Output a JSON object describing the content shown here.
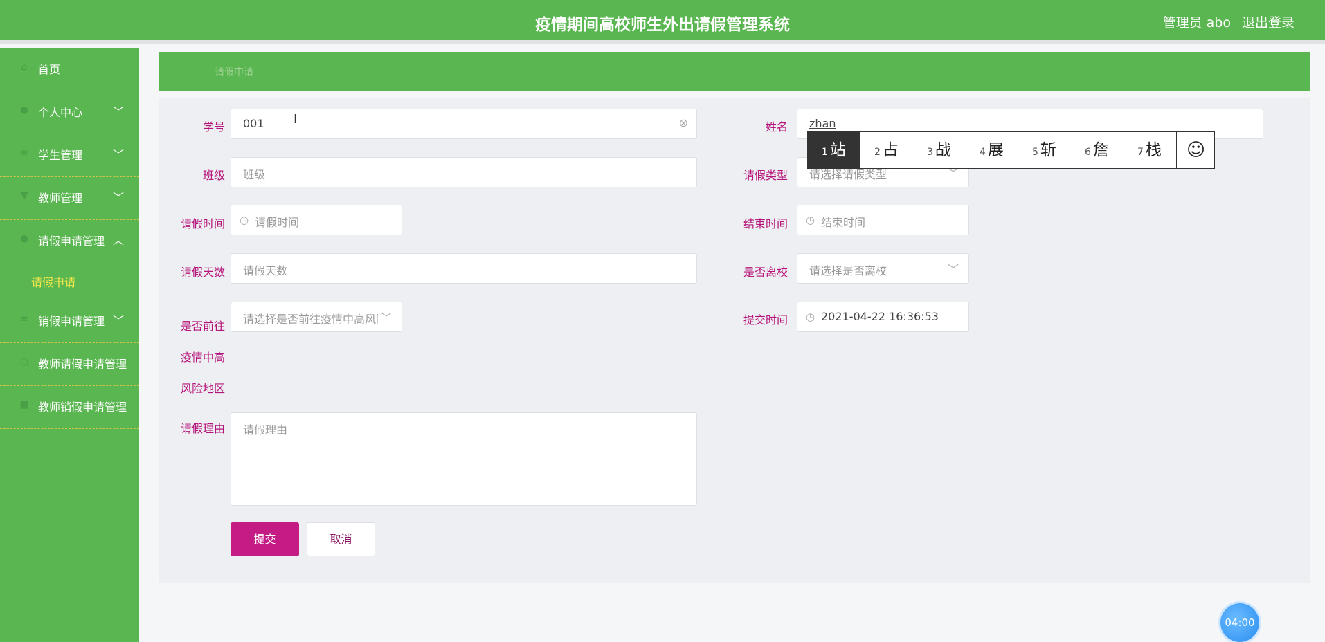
{
  "header": {
    "title": "疫情期间高校师生外出请假管理系统",
    "user": "管理员 abo",
    "logout": "退出登录"
  },
  "sidebar": {
    "items": [
      {
        "label": "首页",
        "icon": "home-icon"
      },
      {
        "label": "个人中心",
        "icon": "user-icon",
        "arrow": "chevron-down"
      },
      {
        "label": "学生管理",
        "icon": "list-icon",
        "arrow": "chevron-down"
      },
      {
        "label": "教师管理",
        "icon": "trophy-icon",
        "arrow": "chevron-down"
      },
      {
        "label": "请假申请管理",
        "icon": "user-icon",
        "arrow": "chevron-up",
        "expanded": true,
        "children": [
          {
            "label": "请假申请",
            "active": true
          }
        ]
      },
      {
        "label": "销假申请管理",
        "icon": "list-icon",
        "arrow": "chevron-down"
      },
      {
        "label": "教师请假申请管理",
        "icon": "circle-icon"
      },
      {
        "label": "教师销假申请管理",
        "icon": "briefcase-icon"
      }
    ]
  },
  "breadcrumb": "请假申请",
  "form": {
    "student_id": {
      "label": "学号",
      "value": "001"
    },
    "name": {
      "label": "姓名",
      "value": "zhan"
    },
    "class": {
      "label": "班级",
      "placeholder": "班级"
    },
    "leave_type": {
      "label": "请假类型",
      "placeholder": "请选择请假类型"
    },
    "leave_time": {
      "label": "请假时间",
      "placeholder": "请假时间"
    },
    "end_time": {
      "label": "结束时间",
      "placeholder": "结束时间"
    },
    "leave_days": {
      "label": "请假天数",
      "placeholder": "请假天数"
    },
    "leave_campus": {
      "label": "是否离校",
      "placeholder": "请选择是否离校"
    },
    "high_risk": {
      "label_lines": [
        "是否前往",
        "疫情中高",
        "风险地区"
      ],
      "placeholder": "请选择是否前往疫情中高风险地区"
    },
    "submit_time": {
      "label": "提交时间",
      "value": "2021-04-22 16:36:53"
    },
    "reason": {
      "label": "请假理由",
      "placeholder": "请假理由"
    },
    "submit_label": "提交",
    "cancel_label": "取消"
  },
  "ime": {
    "candidates": [
      {
        "num": "1",
        "char": "站"
      },
      {
        "num": "2",
        "char": "占"
      },
      {
        "num": "3",
        "char": "战"
      },
      {
        "num": "4",
        "char": "展"
      },
      {
        "num": "5",
        "char": "斩"
      },
      {
        "num": "6",
        "char": "詹"
      },
      {
        "num": "7",
        "char": "栈"
      }
    ],
    "emoji": "☺"
  },
  "timer": "04:00",
  "colors": {
    "header": "#5ab650",
    "label": "#b5147a",
    "submit": "#c41b84",
    "submenu_active": "#f5e84a"
  }
}
